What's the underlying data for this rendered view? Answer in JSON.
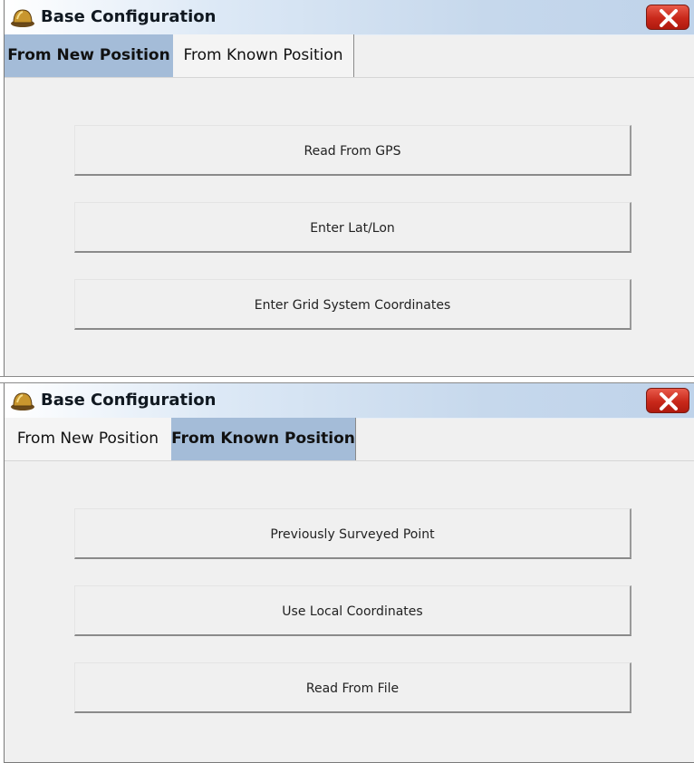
{
  "top_window": {
    "title": "Base Configuration",
    "close_icon": "close-x-icon",
    "app_icon": "hard-hat-icon",
    "tabs": [
      {
        "label": "From New Position",
        "active": true
      },
      {
        "label": "From Known Position",
        "active": false
      }
    ],
    "buttons": [
      "Read From GPS",
      "Enter Lat/Lon",
      "Enter Grid System Coordinates"
    ]
  },
  "bottom_window": {
    "title": "Base Configuration",
    "close_icon": "close-x-icon",
    "app_icon": "hard-hat-icon",
    "tabs": [
      {
        "label": "From New Position",
        "active": false
      },
      {
        "label": "From Known Position",
        "active": true
      }
    ],
    "buttons": [
      "Previously Surveyed Point",
      "Use Local Coordinates",
      "Read From File"
    ]
  },
  "colors": {
    "active_tab": "#a4bcd8",
    "close_button": "#c8281a",
    "panel_background": "#f0f0f0"
  }
}
